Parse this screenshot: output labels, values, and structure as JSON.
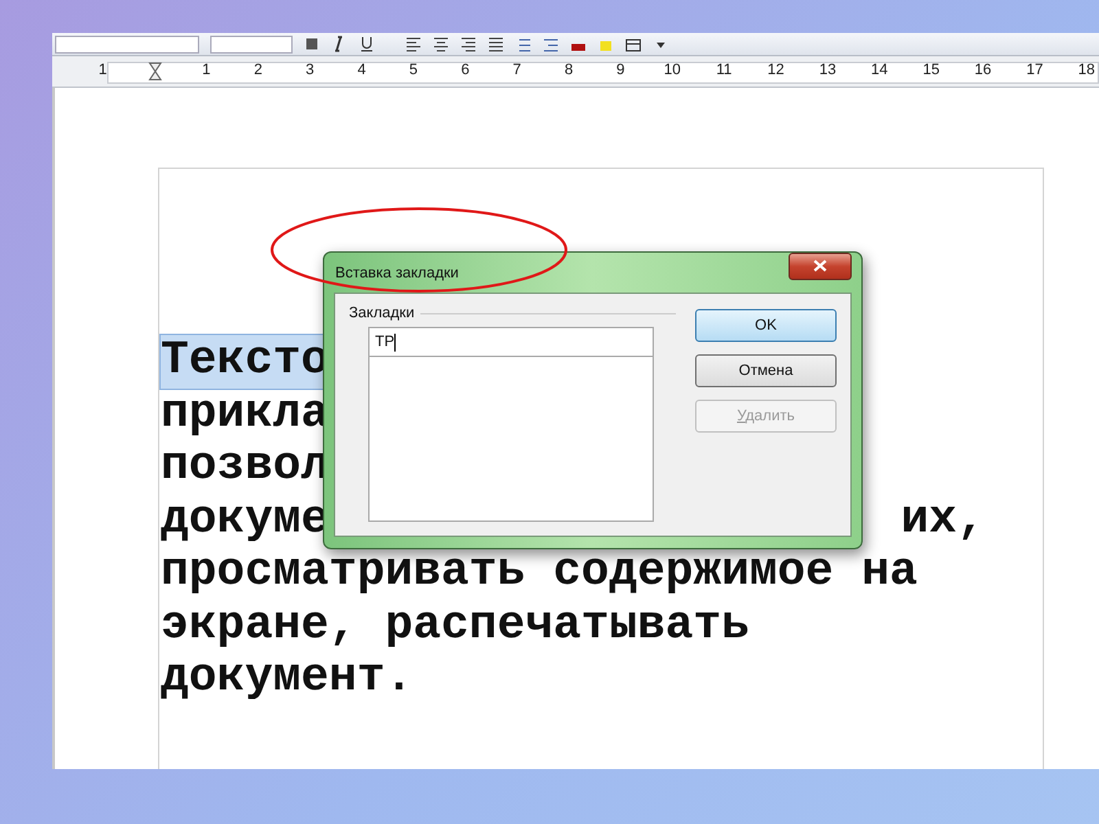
{
  "ruler": {
    "labels": [
      "1",
      "1",
      "2",
      "3",
      "4",
      "5",
      "6",
      "7",
      "8",
      "9",
      "10",
      "11",
      "12",
      "13",
      "14",
      "15",
      "16",
      "17",
      "18"
    ]
  },
  "document": {
    "lines": [
      {
        "segments": [
          {
            "text": "Тексто",
            "kind": "start",
            "selected": true
          }
        ]
      },
      {
        "segments": [
          {
            "text": "прикла",
            "kind": "start",
            "selected": false
          }
        ]
      },
      {
        "segments": [
          {
            "text": "позвол",
            "kind": "start",
            "selected": false
          }
        ]
      },
      {
        "segments": [
          {
            "text": "докуме",
            "kind": "start",
            "selected": false
          },
          {
            "text": "их,",
            "kind": "end",
            "selected": false
          }
        ]
      },
      {
        "segments": [
          {
            "text": "просматривать содержимое на",
            "kind": "start",
            "selected": false
          }
        ]
      },
      {
        "segments": [
          {
            "text": "экране, распечатывать",
            "kind": "start",
            "selected": false
          }
        ]
      },
      {
        "segments": [
          {
            "text": "документ.",
            "kind": "start",
            "selected": false
          }
        ]
      }
    ]
  },
  "dialog": {
    "title": "Вставка закладки",
    "group_label": "Закладки",
    "input": {
      "value": "ТР"
    },
    "buttons": [
      {
        "label": "OK",
        "default": true,
        "disabled": false
      },
      {
        "label": "Отмена",
        "default": false,
        "disabled": false
      },
      {
        "label": "Удалить",
        "default": false,
        "disabled": true
      }
    ]
  }
}
